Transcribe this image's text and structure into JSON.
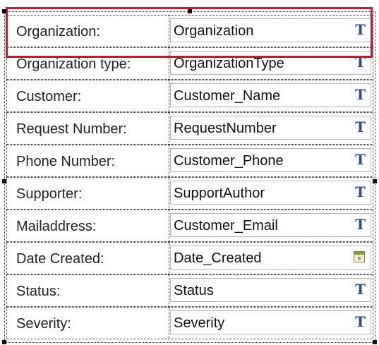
{
  "form": {
    "rows": [
      {
        "label": "Organization:",
        "value": "Organization",
        "icon": "text-field-icon"
      },
      {
        "label": "Organization type:",
        "value": "OrganizationType",
        "icon": "text-field-icon"
      },
      {
        "label": "Customer:",
        "value": "Customer_Name",
        "icon": "text-field-icon"
      },
      {
        "label": "Request Number:",
        "value": "RequestNumber",
        "icon": "text-field-icon"
      },
      {
        "label": "Phone Number:",
        "value": "Customer_Phone",
        "icon": "text-field-icon"
      },
      {
        "label": "Supporter:",
        "value": "SupportAuthor",
        "icon": "text-field-icon"
      },
      {
        "label": "Mailaddress:",
        "value": "Customer_Email",
        "icon": "text-field-icon"
      },
      {
        "label": "Date Created:",
        "value": "Date_Created",
        "icon": "calendar-icon"
      },
      {
        "label": "Status:",
        "value": "Status",
        "icon": "text-field-icon"
      },
      {
        "label": "Severity:",
        "value": "Severity",
        "icon": "text-field-icon"
      }
    ],
    "text_icon_glyph": "T"
  },
  "colors": {
    "highlight": "#b3232d",
    "text_icon": "#2e4c8c",
    "field_border": "#b8b8b8"
  }
}
